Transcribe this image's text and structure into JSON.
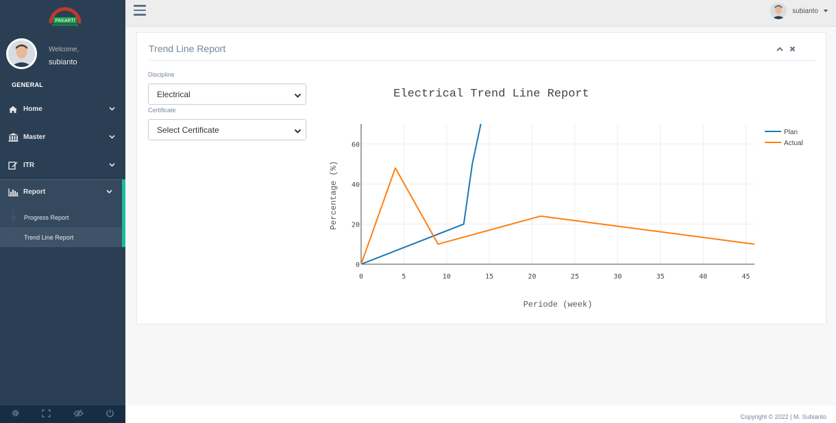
{
  "sidebar": {
    "logo_text": "PAKARTI",
    "welcome": "Welcome,",
    "username": "subianto",
    "section_title": "GENERAL",
    "menu": [
      {
        "label": "Home",
        "icon": "home-icon"
      },
      {
        "label": "Master",
        "icon": "bank-icon"
      },
      {
        "label": "ITR",
        "icon": "edit-icon"
      },
      {
        "label": "Report",
        "icon": "bar-chart-icon"
      }
    ],
    "submenu": [
      {
        "label": "Progress Report"
      },
      {
        "label": "Trend Line Report"
      }
    ],
    "footer_icons": [
      "gear-icon",
      "fullscreen-icon",
      "eye-slash-icon",
      "power-icon"
    ]
  },
  "topnav": {
    "username": "subianto"
  },
  "panel": {
    "title": "Trend Line Report",
    "discipline_label": "Discipline",
    "discipline_value": "Electrical",
    "certificate_label": "Certificate",
    "certificate_value": "Select Certificate"
  },
  "footer": {
    "copyright": "Copyright © 2022 | M. Subianto"
  },
  "colors": {
    "sidebar_bg": "#2a3f54",
    "accent": "#1abb9c",
    "plan": "#1f77b4",
    "actual": "#ff7f0e"
  },
  "chart_data": {
    "type": "line",
    "title": "Electrical Trend Line Report",
    "xlabel": "Periode (week)",
    "ylabel": "Percentage (%)",
    "xlim": [
      0,
      46
    ],
    "ylim": [
      0,
      70
    ],
    "xticks": [
      0,
      5,
      10,
      15,
      20,
      25,
      30,
      35,
      40,
      45
    ],
    "yticks": [
      0,
      20,
      40,
      60
    ],
    "grid": true,
    "legend": "top-right",
    "series": [
      {
        "name": "Plan",
        "color": "#1f77b4",
        "x": [
          0,
          12,
          13,
          14
        ],
        "y": [
          0,
          20,
          50,
          70
        ]
      },
      {
        "name": "Actual",
        "color": "#ff7f0e",
        "x": [
          0,
          4,
          9,
          21,
          46
        ],
        "y": [
          0,
          48,
          10,
          24,
          10
        ]
      }
    ]
  }
}
